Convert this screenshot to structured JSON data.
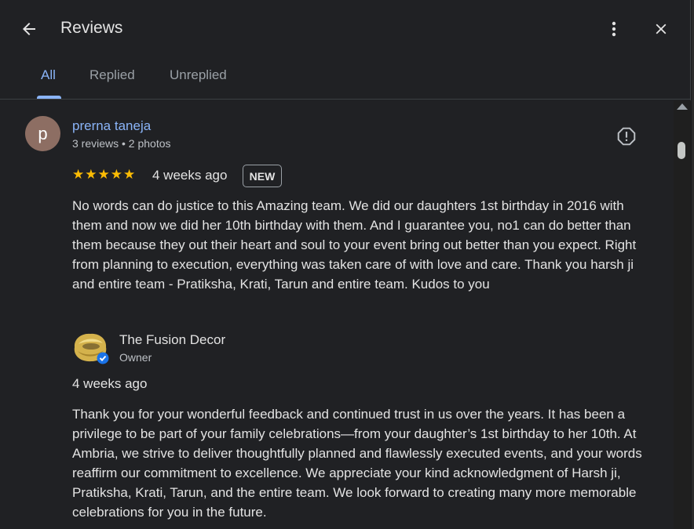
{
  "header": {
    "title": "Reviews",
    "back_icon": "arrow-left-icon",
    "more_icon": "more-vert-icon",
    "close_icon": "close-icon"
  },
  "tabs": [
    {
      "label": "All",
      "active": true
    },
    {
      "label": "Replied",
      "active": false
    },
    {
      "label": "Unreplied",
      "active": false
    }
  ],
  "review": {
    "avatar_letter": "p",
    "reviewer_name": "prerna taneja",
    "reviewer_meta": "3 reviews • 2 photos",
    "stars": "★★★★★",
    "rating": 5,
    "date": "4 weeks ago",
    "badge": "NEW",
    "text": "No words can do justice to this Amazing team. We did our daughters 1st birthday in 2016 with them and now we did her 10th birthday with them. And I guarantee you, no1 can do better than them because they out their heart and soul to your event bring out better than you expect. Right from planning to execution, everything was taken care of with love and care. Thank you harsh ji and entire team - Pratiksha, Krati, Tarun and entire team. Kudos to you"
  },
  "reply": {
    "owner_name": "The Fusion Decor",
    "owner_role": "Owner",
    "date": "4 weeks ago",
    "text": "Thank you for your wonderful feedback and continued trust in us over the years. It has been a privilege to be part of your family celebrations—from your daughter’s 1st birthday to her 10th. At Ambria, we strive to deliver thoughtfully planned and flawlessly executed events, and your words reaffirm our commitment to excellence. We appreciate your kind acknowledgment of Harsh ji, Pratiksha, Krati, Tarun, and the entire team. We look forward to creating many more memorable celebrations for you in the future."
  },
  "colors": {
    "background": "#202124",
    "accent": "#8ab4f8",
    "star": "#fbbc04",
    "verified": "#1a73e8"
  }
}
